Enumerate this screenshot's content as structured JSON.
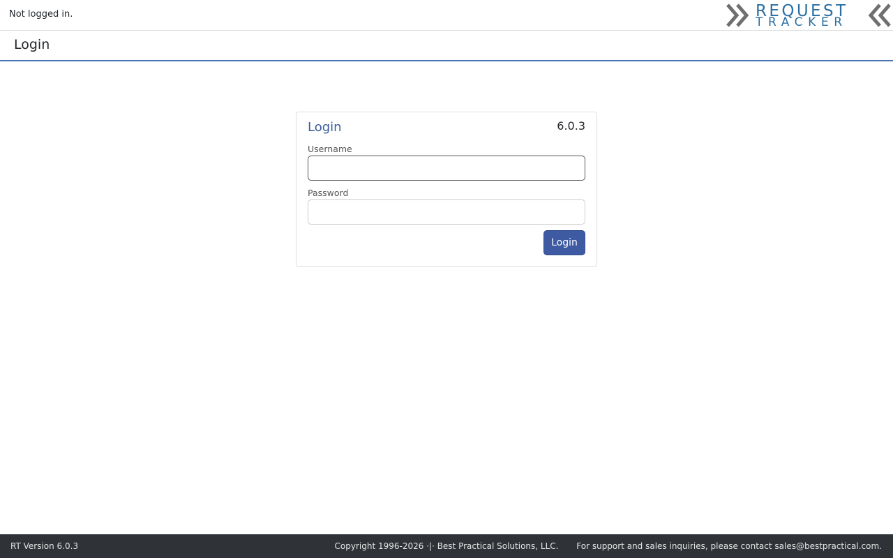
{
  "topbar": {
    "login_status": "Not logged in.",
    "logo": {
      "line1": "REQUEST",
      "line2": "TRACKER",
      "icon_left": "chevron-double-right-icon",
      "icon_right": "chevron-double-left-icon"
    }
  },
  "page": {
    "title": "Login"
  },
  "login_card": {
    "title": "Login",
    "version": "6.0.3",
    "username_label": "Username",
    "username_value": "",
    "password_label": "Password",
    "password_value": "",
    "submit_label": "Login"
  },
  "footer": {
    "version": "RT Version 6.0.3",
    "copyright": "Copyright 1996-2026 ·|· Best Practical Solutions, LLC.",
    "support": "For support and sales inquiries, please contact sales@bestpractical.com."
  },
  "colors": {
    "accent": "#3d5aa2",
    "title_blue": "#3a5d9c",
    "logo_blue": "#2c6fa3",
    "logo_gray": "#6f6f6f",
    "footer_bg": "#2f3337",
    "header_rule": "#4a73b2"
  }
}
